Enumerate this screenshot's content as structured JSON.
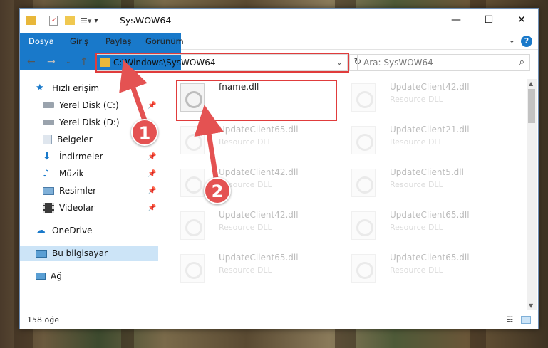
{
  "window": {
    "title": "SysWOW64",
    "controls": {
      "minimize": "—",
      "maximize": "☐",
      "close": "✕"
    }
  },
  "ribbon": {
    "tabs": [
      "Dosya",
      "Giriş",
      "Paylaş",
      "Görünüm"
    ],
    "help": "?"
  },
  "navigation": {
    "address": "C:\\Windows\\SysWOW64",
    "search_placeholder": "Ara: SysWOW64"
  },
  "sidebar": {
    "items": [
      {
        "label": "Hızlı erişim",
        "icon": "star-icon",
        "pinned": false
      },
      {
        "label": "Yerel Disk (C:)",
        "icon": "drive-icon",
        "pinned": true
      },
      {
        "label": "Yerel Disk (D:)",
        "icon": "drive-icon",
        "pinned": false
      },
      {
        "label": "Belgeler",
        "icon": "documents-icon",
        "pinned": true
      },
      {
        "label": "İndirmeler",
        "icon": "download-icon",
        "pinned": true
      },
      {
        "label": "Müzik",
        "icon": "music-icon",
        "pinned": true
      },
      {
        "label": "Resimler",
        "icon": "pictures-icon",
        "pinned": true
      },
      {
        "label": "Videolar",
        "icon": "video-icon",
        "pinned": true
      },
      {
        "label": "OneDrive",
        "icon": "cloud-icon",
        "pinned": false
      },
      {
        "label": "Bu bilgisayar",
        "icon": "computer-icon",
        "pinned": false,
        "selected": true
      },
      {
        "label": "Ağ",
        "icon": "network-icon",
        "pinned": false
      }
    ]
  },
  "files": [
    {
      "name": "fname.dll",
      "type": ""
    },
    {
      "name": "UpdateClient42.dll",
      "type": "Resource DLL"
    },
    {
      "name": "UpdateClient65.dll",
      "type": "Resource DLL"
    },
    {
      "name": "UpdateClient21.dll",
      "type": "Resource DLL"
    },
    {
      "name": "UpdateClient42.dll",
      "type": "Resource DLL"
    },
    {
      "name": "UpdateClient5.dll",
      "type": "Resource DLL"
    },
    {
      "name": "UpdateClient42.dll",
      "type": "Resource DLL"
    },
    {
      "name": "UpdateClient65.dll",
      "type": "Resource DLL"
    },
    {
      "name": "UpdateClient65.dll",
      "type": "Resource DLL"
    },
    {
      "name": "UpdateClient65.dll",
      "type": "Resource DLL"
    }
  ],
  "status": {
    "item_count": "158 öğe"
  },
  "annotations": {
    "badge1": "1",
    "badge2": "2"
  },
  "colors": {
    "accent": "#1979ca",
    "annotation": "#e45252",
    "selected": "#cce4f7"
  }
}
